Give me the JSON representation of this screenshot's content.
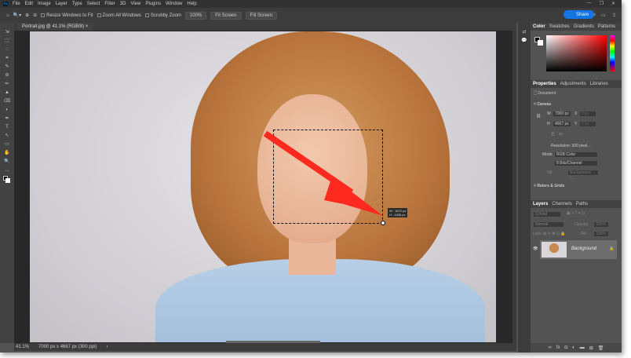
{
  "menu": [
    "File",
    "Edit",
    "Image",
    "Layer",
    "Type",
    "Select",
    "Filter",
    "3D",
    "View",
    "Plugins",
    "Window",
    "Help"
  ],
  "window_controls": [
    "—",
    "❐",
    "✕"
  ],
  "options": {
    "resize_windows": "Resize Windows to Fit",
    "zoom_all": "Zoom All Windows",
    "scrubby": "Scrubby Zoom",
    "zoom_pct": "100%",
    "fit_screen": "Fit Screen",
    "fill_screen": "Fill Screen",
    "share": "Share"
  },
  "document_tab": {
    "title": "Portrait.jpg @ 41.1% (RGB/8)",
    "close": "×"
  },
  "tools": [
    "⇲",
    "⬚",
    "◌",
    "⌗",
    "✎",
    "⊘",
    "✏",
    "▲",
    "⌫",
    "◐",
    "✒",
    "T",
    "↖",
    "▭",
    "✋",
    "🔍",
    "…"
  ],
  "selection_tooltip": {
    "w": "W : 1672 px",
    "h": "H : 1406 px"
  },
  "status": {
    "zoom": "41.1%",
    "info": "7000 px x 4667 px (300 ppi)"
  },
  "color_panel": {
    "tabs": [
      "Color",
      "Swatches",
      "Gradients",
      "Patterns"
    ],
    "foreground": "#000000",
    "background": "#ffffff"
  },
  "properties": {
    "tabs": [
      "Properties",
      "Adjustments",
      "Libraries"
    ],
    "document_label": "Document",
    "canvas_header": "Canvas",
    "w_label": "W",
    "w_value": "7000 px",
    "h_label": "H",
    "h_value": "4667 px",
    "x_label": "X",
    "x_value": "0 px",
    "y_label": "Y",
    "y_value": "0 px",
    "resolution": "Resolution: 300 pixel...",
    "mode_label": "Mode",
    "mode_value": "RGB Color",
    "depth_value": "8 Bits/Channel",
    "fill_label": "Fill",
    "fill_value": "Background C...",
    "rulers_header": "Rulers & Grids"
  },
  "layers": {
    "tabs": [
      "Layers",
      "Channels",
      "Paths"
    ],
    "kind": "Q Kind",
    "blend": "Normal",
    "opacity_label": "Opacity:",
    "opacity_value": "100%",
    "lock_label": "Lock:",
    "fill_label": "Fill:",
    "fill_value": "100%",
    "items": [
      {
        "name": "Background",
        "locked": true,
        "visible": true
      }
    ]
  },
  "accent": "#1473e6",
  "arrow_color": "#ff2a1f"
}
